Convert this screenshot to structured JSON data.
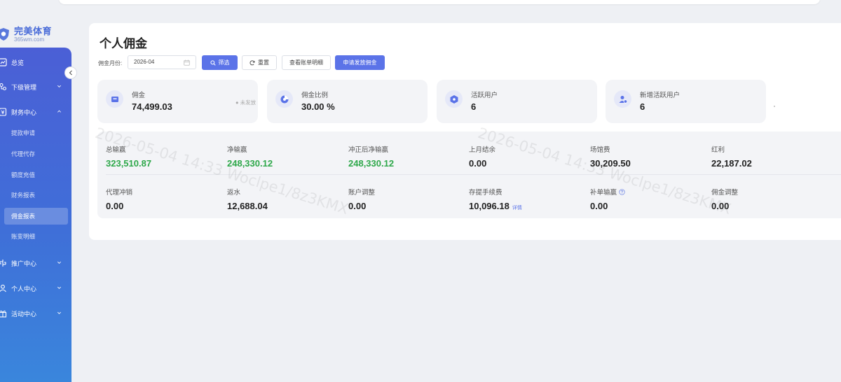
{
  "logo": {
    "title": "完美体育",
    "subtitle": "365wm.com"
  },
  "sidebar": {
    "items": [
      {
        "label": "总览"
      },
      {
        "label": "下级管理"
      },
      {
        "label": "财务中心"
      },
      {
        "label": "推广中心"
      },
      {
        "label": "个人中心"
      },
      {
        "label": "活动中心"
      }
    ],
    "finance_sub": [
      "提款申请",
      "代理代存",
      "额度充值",
      "财务报表",
      "佣金报表",
      "账变明细"
    ]
  },
  "page": {
    "title": "个人佣金"
  },
  "filter": {
    "label": "佣金月份:",
    "month_value": "2026-04",
    "search_label": "筛选",
    "reset_label": "重置",
    "bill_label": "查看账单明细",
    "apply_label": "申请发放佣金"
  },
  "stats": [
    {
      "label": "佣金",
      "value": "74,499.03",
      "status": "未发放"
    },
    {
      "label": "佣金比例",
      "value": "30.00 %"
    },
    {
      "label": "活跃用户",
      "value": "6"
    },
    {
      "label": "新增活跃用户",
      "value": "6"
    }
  ],
  "details": [
    {
      "label": "总输赢",
      "value": "323,510.87"
    },
    {
      "label": "净输赢",
      "value": "248,330.12"
    },
    {
      "label": "冲正后净输赢",
      "value": "248,330.12"
    },
    {
      "label": "上月结余",
      "value": "0.00"
    },
    {
      "label": "场馆费",
      "value": "30,209.50"
    },
    {
      "label": "红利",
      "value": "22,187.02"
    },
    {
      "label": "代理冲销",
      "value": "0.00"
    },
    {
      "label": "返水",
      "value": "12,688.04"
    },
    {
      "label": "账户调整",
      "value": "0.00"
    },
    {
      "label": "存提手续费",
      "value": "10,096.18",
      "link": "详情"
    },
    {
      "label": "补单输赢",
      "value": "0.00"
    },
    {
      "label": "佣金调整",
      "value": "0.00"
    }
  ],
  "watermark": {
    "text": "2026-05-04 14:33  Woclpe1/8z3KMX"
  },
  "colors": {
    "primary": "#5b73e8",
    "positive": "#2ea84a",
    "sidebar_top": "#4b5fd6",
    "sidebar_bottom": "#3a86dc"
  }
}
